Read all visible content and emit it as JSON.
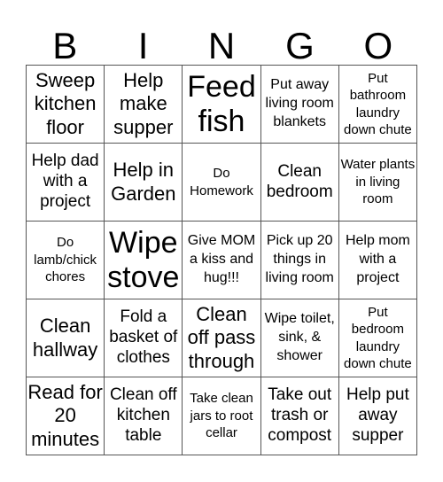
{
  "header": {
    "letters": [
      "B",
      "I",
      "N",
      "G",
      "O"
    ]
  },
  "card": {
    "rows": [
      [
        {
          "text": "Sweep kitchen floor",
          "size": "l"
        },
        {
          "text": "Help make supper",
          "size": "l"
        },
        {
          "text": "Feed fish",
          "size": "xl"
        },
        {
          "text": "Put away living room blankets",
          "size": "s"
        },
        {
          "text": "Put bathroom laundry down chute",
          "size": "xs"
        }
      ],
      [
        {
          "text": "Help dad with a project",
          "size": "m"
        },
        {
          "text": "Help in Garden",
          "size": "l"
        },
        {
          "text": "Do Homework",
          "size": "xs"
        },
        {
          "text": "Clean bedroom",
          "size": "m"
        },
        {
          "text": "Water plants in living room",
          "size": "xs"
        }
      ],
      [
        {
          "text": "Do lamb/chick chores",
          "size": "xs"
        },
        {
          "text": "Wipe stove",
          "size": "xl"
        },
        {
          "text": "Give MOM a kiss and hug!!!",
          "size": "s"
        },
        {
          "text": "Pick up 20 things in living room",
          "size": "s"
        },
        {
          "text": "Help mom with a project",
          "size": "s"
        }
      ],
      [
        {
          "text": "Clean hallway",
          "size": "l"
        },
        {
          "text": "Fold a basket of clothes",
          "size": "m"
        },
        {
          "text": "Clean off pass through",
          "size": "l"
        },
        {
          "text": "Wipe toilet, sink, & shower",
          "size": "s"
        },
        {
          "text": "Put bedroom laundry down chute",
          "size": "xs"
        }
      ],
      [
        {
          "text": "Read for 20 minutes",
          "size": "l"
        },
        {
          "text": "Clean off kitchen table",
          "size": "m"
        },
        {
          "text": "Take clean jars to root cellar",
          "size": "xs"
        },
        {
          "text": "Take out trash or compost",
          "size": "m"
        },
        {
          "text": "Help put away supper",
          "size": "m"
        }
      ]
    ]
  }
}
